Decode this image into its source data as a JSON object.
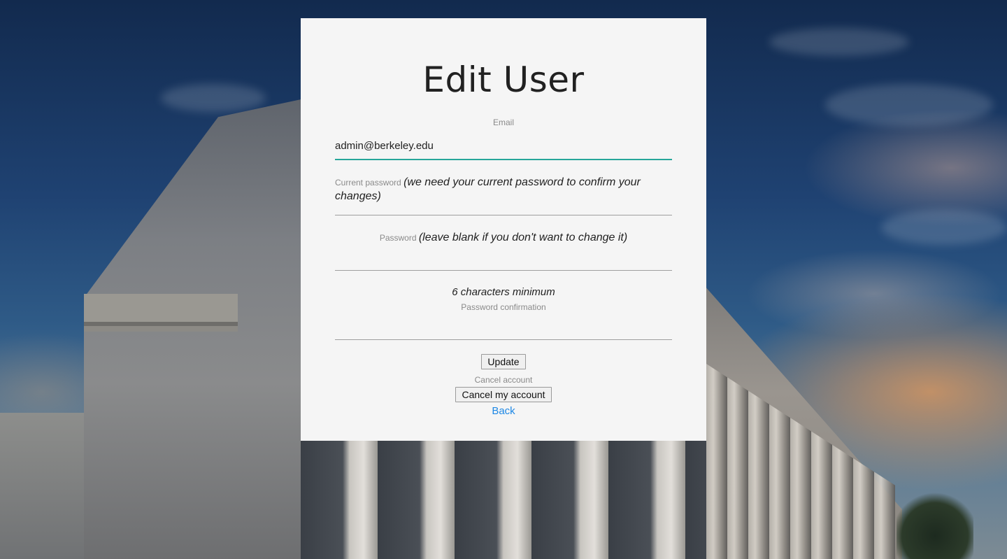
{
  "page": {
    "title": "Edit User"
  },
  "form": {
    "email": {
      "label": "Email",
      "value": "admin@berkeley.edu"
    },
    "current_password": {
      "label": "Current password",
      "hint": "(we need your current password to confirm your changes)",
      "value": ""
    },
    "password": {
      "label": "Password",
      "hint": "(leave blank if you don't want to change it)",
      "value": ""
    },
    "min_note": "6 characters minimum",
    "password_confirmation": {
      "label": "Password confirmation",
      "value": ""
    },
    "update_button": "Update"
  },
  "cancel": {
    "label": "Cancel account",
    "button": "Cancel my account"
  },
  "back_link": "Back",
  "colors": {
    "accent": "#26a69a",
    "link": "#1e88e5",
    "card_bg": "#f5f5f5"
  }
}
